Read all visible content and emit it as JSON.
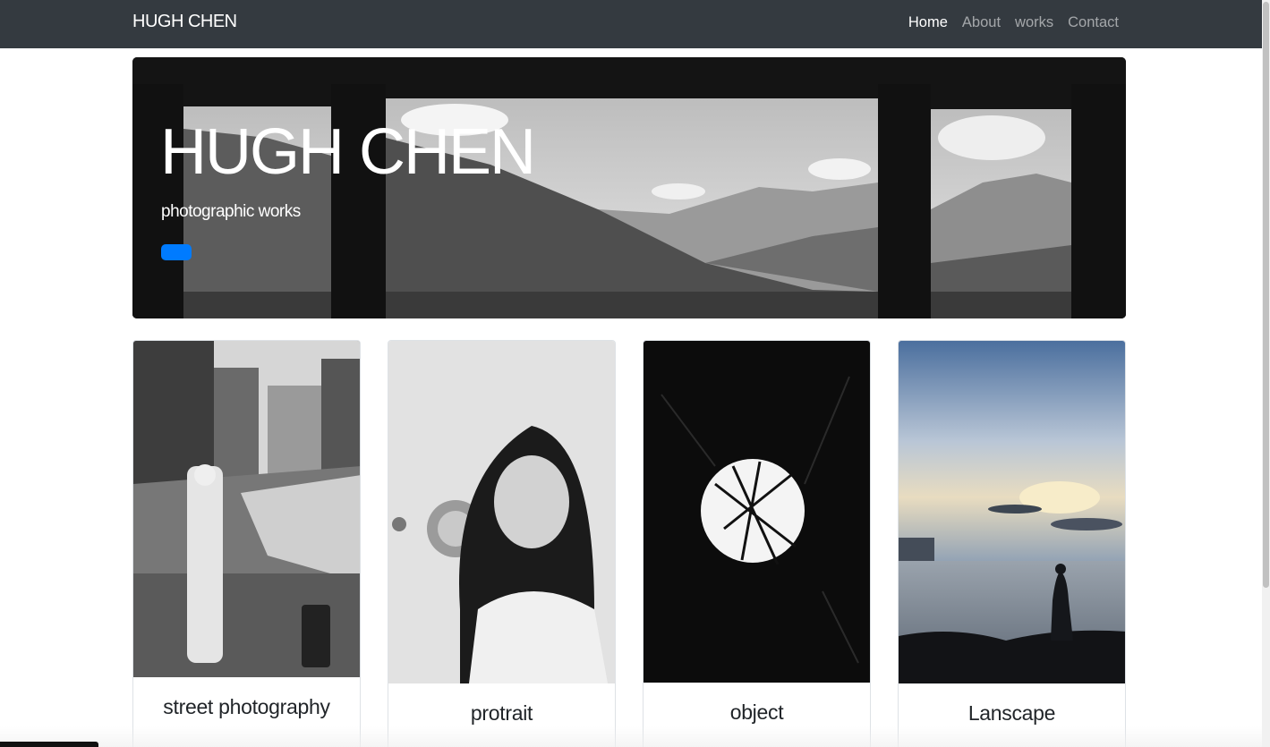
{
  "navbar": {
    "brand": "HUGH CHEN",
    "links": [
      {
        "label": "Home",
        "active": true
      },
      {
        "label": "About",
        "active": false
      },
      {
        "label": "works",
        "active": false
      },
      {
        "label": "Contact",
        "active": false
      }
    ]
  },
  "hero": {
    "title": "HUGH CHEN",
    "subtitle": "photographic works",
    "button_color": "#007bff"
  },
  "cards": [
    {
      "title": "street photography"
    },
    {
      "title": "protrait"
    },
    {
      "title": "object"
    },
    {
      "title": "Lanscape"
    }
  ],
  "colors": {
    "navbar_bg": "#343a40",
    "accent": "#007bff"
  }
}
